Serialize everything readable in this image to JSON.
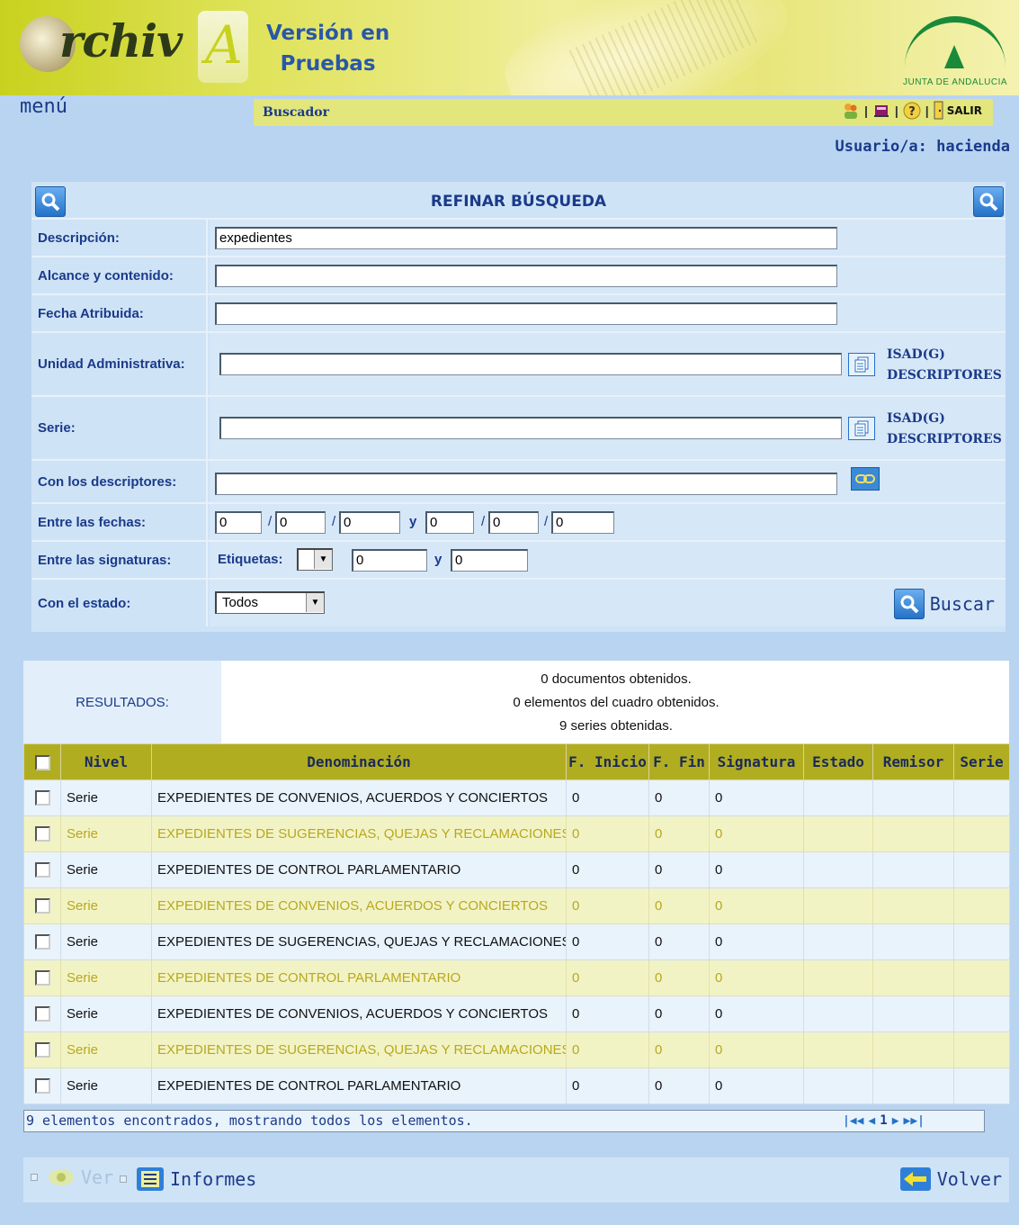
{
  "header": {
    "app_name_main": "rchiv",
    "app_name_end": "A",
    "version_line1": "Versión en",
    "version_line2": "Pruebas",
    "institution": "JUNTA DE ANDALUCIA"
  },
  "menubar": {
    "menu_label": "menú",
    "section": "Buscador",
    "salir_label": "SALIR",
    "separator": "|"
  },
  "user": {
    "text": "Usuario/a: hacienda"
  },
  "search": {
    "title": "REFINAR BÚSQUEDA",
    "fields": {
      "descripcion": {
        "label": "Descripción:",
        "value": "expedientes"
      },
      "alcance": {
        "label": "Alcance y contenido:",
        "value": ""
      },
      "fecha_atribuida": {
        "label": "Fecha Atribuida:",
        "value": ""
      },
      "unidad": {
        "label": "Unidad Administrativa:",
        "value": "",
        "link1": "ISAD(G)",
        "link2": "DESCRIPTORES"
      },
      "serie": {
        "label": "Serie:",
        "value": "",
        "link1": "ISAD(G)",
        "link2": "DESCRIPTORES"
      },
      "descriptores": {
        "label": "Con los descriptores:",
        "value": ""
      },
      "fechas": {
        "label": "Entre las fechas:",
        "values": [
          "0",
          "0",
          "0",
          "0",
          "0",
          "0"
        ],
        "slash": "/",
        "and": "y"
      },
      "signaturas": {
        "label": "Entre las signaturas:",
        "etiquetas_label": "Etiquetas:",
        "from": "0",
        "to": "0",
        "and": "y"
      },
      "estado": {
        "label": "Con el estado:",
        "selected": "Todos"
      }
    },
    "buscar_label": "Buscar"
  },
  "results": {
    "label": "RESULTADOS:",
    "lines": [
      "0 documentos obtenidos.",
      "0 elementos del cuadro obtenidos.",
      "9 series obtenidas."
    ]
  },
  "table": {
    "headers": [
      "Nivel",
      "Denominación",
      "F. Inicio",
      "F. Fin",
      "Signatura",
      "Estado",
      "Remisor",
      "Serie"
    ],
    "rows": [
      [
        "Serie",
        "EXPEDIENTES DE CONVENIOS, ACUERDOS Y CONCIERTOS",
        "0",
        "0",
        "0",
        "",
        "",
        ""
      ],
      [
        "Serie",
        "EXPEDIENTES DE SUGERENCIAS, QUEJAS Y RECLAMACIONES",
        "0",
        "0",
        "0",
        "",
        "",
        ""
      ],
      [
        "Serie",
        "EXPEDIENTES DE CONTROL PARLAMENTARIO",
        "0",
        "0",
        "0",
        "",
        "",
        ""
      ],
      [
        "Serie",
        "EXPEDIENTES DE CONVENIOS, ACUERDOS Y CONCIERTOS",
        "0",
        "0",
        "0",
        "",
        "",
        ""
      ],
      [
        "Serie",
        "EXPEDIENTES DE SUGERENCIAS, QUEJAS Y RECLAMACIONES",
        "0",
        "0",
        "0",
        "",
        "",
        ""
      ],
      [
        "Serie",
        "EXPEDIENTES DE CONTROL PARLAMENTARIO",
        "0",
        "0",
        "0",
        "",
        "",
        ""
      ],
      [
        "Serie",
        "EXPEDIENTES DE CONVENIOS, ACUERDOS Y CONCIERTOS",
        "0",
        "0",
        "0",
        "",
        "",
        ""
      ],
      [
        "Serie",
        "EXPEDIENTES DE SUGERENCIAS, QUEJAS Y RECLAMACIONES",
        "0",
        "0",
        "0",
        "",
        "",
        ""
      ],
      [
        "Serie",
        "EXPEDIENTES DE CONTROL PARLAMENTARIO",
        "0",
        "0",
        "0",
        "",
        "",
        ""
      ]
    ],
    "footer_text": "9 elementos encontrados, mostrando todos los elementos.",
    "page": "1"
  },
  "bottom": {
    "ver_label": "Ver",
    "informes_label": "Informes",
    "volver_label": "Volver"
  },
  "colors": {
    "banner": "#c8d21e",
    "page_bg": "#b9d4f1",
    "table_header": "#b1ad21",
    "link_blue": "#1a3a8a"
  },
  "icons": [
    "user-group-icon",
    "book-icon",
    "help-icon",
    "exit-door-icon",
    "search-icon",
    "document-list-icon",
    "link-chain-icon",
    "view-eye-icon",
    "report-icon",
    "back-arrow-icon",
    "first-page-icon",
    "prev-page-icon",
    "next-page-icon",
    "last-page-icon"
  ]
}
